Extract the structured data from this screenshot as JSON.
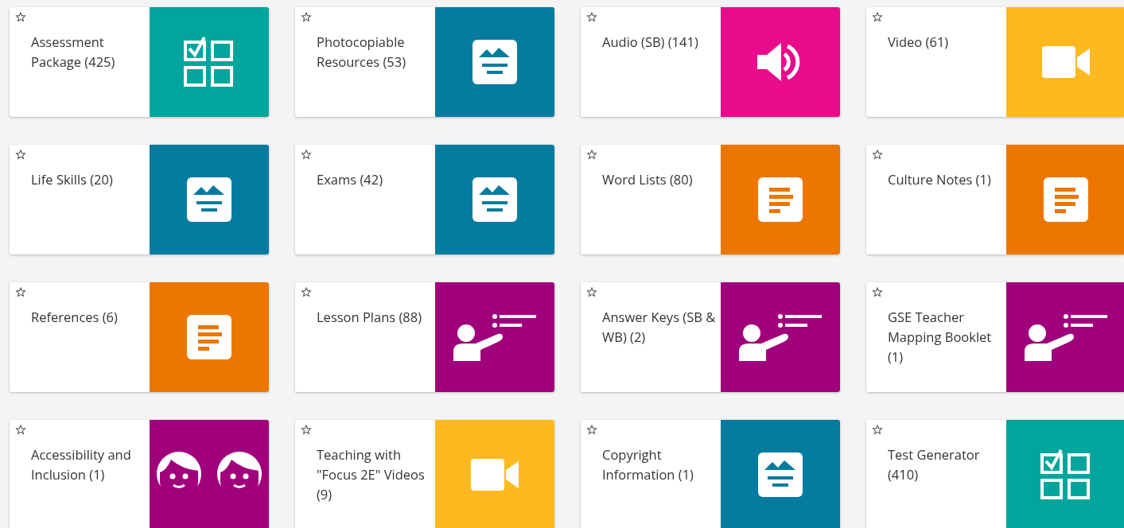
{
  "tiles": [
    {
      "label": "Assessment Package (425)",
      "kind": "checklist",
      "color": "#00a69c"
    },
    {
      "label": "Photocopiable Resources (53)",
      "kind": "document",
      "color": "#067ba0"
    },
    {
      "label": "Audio (SB) (141)",
      "kind": "audio",
      "color": "#ea0a8c"
    },
    {
      "label": "Video (61)",
      "kind": "video",
      "color": "#fdb91d"
    },
    {
      "label": "Life Skills (20)",
      "kind": "document",
      "color": "#067ba0"
    },
    {
      "label": "Exams (42)",
      "kind": "document",
      "color": "#067ba0"
    },
    {
      "label": "Word Lists (80)",
      "kind": "notes",
      "color": "#ec7601"
    },
    {
      "label": "Culture Notes (1)",
      "kind": "notes",
      "color": "#ec7601"
    },
    {
      "label": "References (6)",
      "kind": "notes",
      "color": "#ec7601"
    },
    {
      "label": "Lesson Plans (88)",
      "kind": "presenter",
      "color": "#a0007c"
    },
    {
      "label": "Answer Keys (SB & WB) (2)",
      "kind": "presenter",
      "color": "#a0007c"
    },
    {
      "label": "GSE Teacher Mapping Booklet (1)",
      "kind": "presenter",
      "color": "#a0007c"
    },
    {
      "label": "Accessibility and Inclusion (1)",
      "kind": "faces",
      "color": "#a0007c"
    },
    {
      "label": "Teaching with \"Focus 2E\" Videos (9)",
      "kind": "video",
      "color": "#fdb91d"
    },
    {
      "label": "Copyright Information (1)",
      "kind": "document",
      "color": "#067ba0"
    },
    {
      "label": "Test Generator (410)",
      "kind": "checklist",
      "color": "#00a69c"
    }
  ]
}
